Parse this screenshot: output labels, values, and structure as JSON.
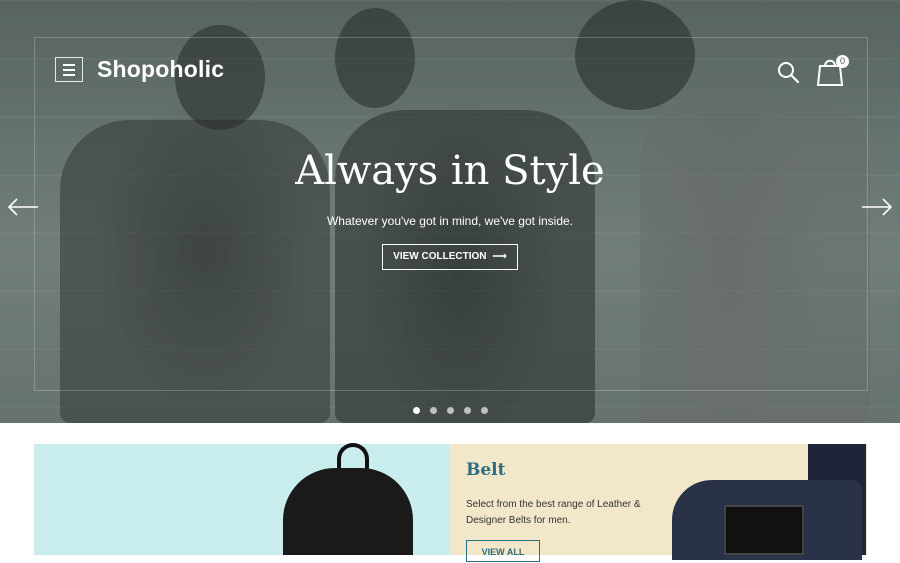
{
  "header": {
    "brand": "Shopoholic",
    "cart_count": "0"
  },
  "hero": {
    "headline": "Always in Style",
    "subline": "Whatever you've got in mind, we've got inside.",
    "cta_label": "VIEW COLLECTION",
    "slides": 5,
    "active_slide": 1
  },
  "promo": {
    "title": "Belt",
    "description": "Select from the best range of Leather & Designer Belts for men.",
    "button_label": "VIEW ALL"
  },
  "colors": {
    "accent": "#2a6d85",
    "promo_left_bg": "#c9ecec",
    "promo_right_bg": "#f2e7c9"
  }
}
